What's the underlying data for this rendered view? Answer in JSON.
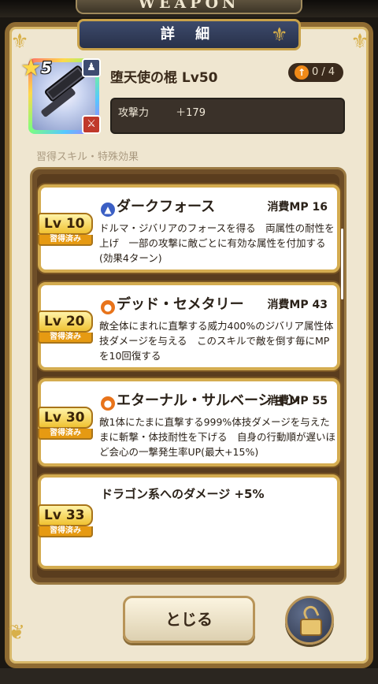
{
  "header": {
    "banner_text": "WEAPON"
  },
  "dialog": {
    "title": "詳 細"
  },
  "weapon": {
    "rarity_stars": "5",
    "name": "堕天使の棍 Lv50",
    "upgrade": "0 / 4",
    "stat_label": "攻撃力",
    "stat_value": "＋179"
  },
  "section": {
    "label": "習得スキル・特殊効果"
  },
  "skills": [
    {
      "level": "Lv 10",
      "status": "習得済み",
      "name": "ダークフォース",
      "icon_color": "#3b5fc4",
      "mp": "消費MP  16",
      "desc": "ドルマ・ジバリアのフォースを得る　両属性の耐性を上げ　一部の攻撃に敵ごとに有効な属性を付加する(効果4ターン)"
    },
    {
      "level": "Lv 20",
      "status": "習得済み",
      "name": "デッド・セメタリー",
      "icon_color": "#e8731a",
      "mp": "消費MP  43",
      "desc": "敵全体にまれに直撃する威力400%のジバリア属性体技ダメージを与える　このスキルで敵を倒す毎にMPを10回復する"
    },
    {
      "level": "Lv 30",
      "status": "習得済み",
      "name": "エターナル・サルベーション",
      "icon_color": "#e8731a",
      "mp": "消費MP  55",
      "desc": "敵1体にたまに直撃する999%体技ダメージを与えたまに斬撃・体技耐性を下げる　自身の行動順が遅いほど会心の一撃発生率UP(最大+15%)"
    },
    {
      "level": "Lv 33",
      "status": "習得済み",
      "name": "ドラゴン系へのダメージ +5%",
      "icon_color": "",
      "mp": "",
      "desc": ""
    }
  ],
  "buttons": {
    "close_label": "とじる"
  },
  "icons": {
    "lock": "unlock-icon",
    "star": "star-icon",
    "upgrade": "arrow-up-icon"
  }
}
